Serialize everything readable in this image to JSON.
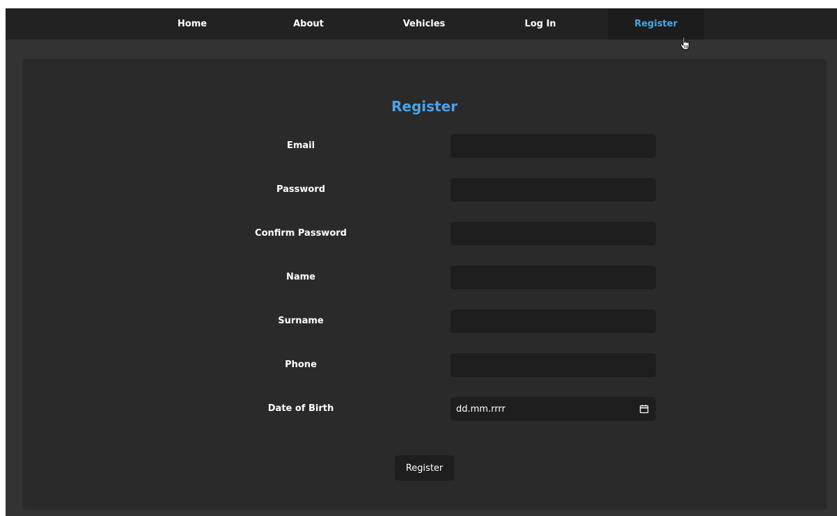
{
  "nav": {
    "items": [
      {
        "label": "Home"
      },
      {
        "label": "About"
      },
      {
        "label": "Vehicles"
      },
      {
        "label": "Log In"
      },
      {
        "label": "Register",
        "active": true
      }
    ]
  },
  "form": {
    "title": "Register",
    "fields": [
      {
        "label": "Email",
        "value": ""
      },
      {
        "label": "Password",
        "value": ""
      },
      {
        "label": "Confirm Password",
        "value": ""
      },
      {
        "label": "Name",
        "value": ""
      },
      {
        "label": "Surname",
        "value": ""
      },
      {
        "label": "Phone",
        "value": ""
      },
      {
        "label": "Date of Birth",
        "placeholder": "dd.mm.rrrr"
      }
    ],
    "submit_label": "Register"
  },
  "colors": {
    "accent": "#4aa3e8",
    "navbar_bg": "#222222",
    "panel_bg": "#2a2a2a",
    "input_bg": "#1e1e1e"
  },
  "icons": {
    "date_picker": "calendar-icon",
    "pointer": "hand-cursor-icon"
  }
}
